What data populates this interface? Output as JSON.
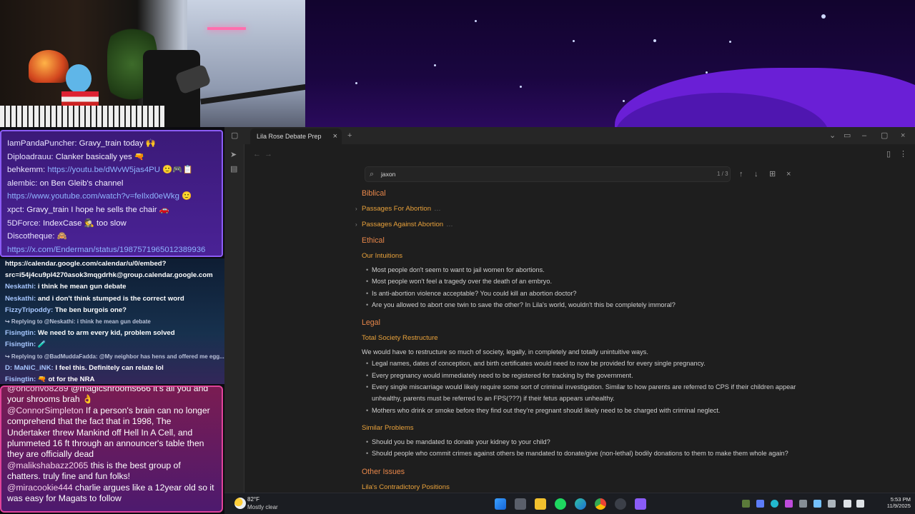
{
  "chat1": {
    "lines": [
      {
        "user": "IamPandaPuncher:",
        "text": " Gravy_train today 🙌"
      },
      {
        "user": "Diploadrauu:",
        "text": " Clanker basically yes 🔫"
      },
      {
        "user": "behkemm:",
        "link": " https://youtu.be/dWvW5jas4PU",
        "text": " 🙂🎮📋"
      },
      {
        "user": "alembic:",
        "text": " on Ben Gleib's channel"
      },
      {
        "user": "",
        "link": "https://www.youtube.com/watch?v=feIlxd0eWkg",
        "text": " 🙂"
      },
      {
        "user": "xpct:",
        "text": " Gravy_train I hope he sells the chair 🚗"
      },
      {
        "user": "5DForce:",
        "text": " IndexCase 🕵 too slow"
      },
      {
        "user": "Discotheque:",
        "text": " 🙈"
      },
      {
        "user": "",
        "link": "https://x.com/Enderman/status/1987571965012389936",
        "text": ""
      }
    ]
  },
  "chat2": {
    "lines": [
      {
        "kind": "msg",
        "user": "",
        "text": "https://calendar.google.com/calendar/u/0/embed?"
      },
      {
        "kind": "msg",
        "user": "",
        "text": "src=i54j4cu9pl4270asok3mqgdrhk@group.calendar.google.com"
      },
      {
        "kind": "msg",
        "user": "Neskathi:",
        "text": " i think he mean gun debate"
      },
      {
        "kind": "msg",
        "user": "Neskathi:",
        "text": " and i don't think stumped is the correct word"
      },
      {
        "kind": "msg",
        "user": "FizzyTripoddy:",
        "text": " The ben burgois one?"
      },
      {
        "kind": "reply",
        "user": "",
        "text": "↪ Replying to @Neskathi: i think he mean gun debate"
      },
      {
        "kind": "msg",
        "user": "Fisingtin:",
        "text": " We need to arm every kid, problem solved"
      },
      {
        "kind": "msg",
        "user": "Fisingtin:",
        "text": " 🧪"
      },
      {
        "kind": "reply",
        "user": "",
        "text": "↪ Replying to @BadMuddaFadda: @My neighbor has hens and offered me egg..."
      },
      {
        "kind": "msg",
        "user": "D: MaNiC_iNK:",
        "text": " I feel this. Definitely can relate lol"
      },
      {
        "kind": "msg",
        "user": "Fisingtin:",
        "text": " 🔫 ot for the NRA"
      }
    ]
  },
  "chat3": {
    "lines": [
      {
        "user": "@onconvo8289",
        "text": " @magicshrooms666 it's all you and your shrooms brah 👌"
      },
      {
        "user": "@ConnorSimpleton",
        "text": " If a person's brain can no longer comprehend that the fact that in 1998, The Undertaker threw Mankind off Hell In A Cell, and plummeted 16 ft through an announcer's table then they are officially dead"
      },
      {
        "user": "@malikshabazz2065",
        "text": " this is the best group of chatters. truly fine and fun folks!"
      },
      {
        "user": "@miracookie444",
        "text": " charlie argues like a 12year old so it was easy for Magats to follow"
      }
    ]
  },
  "app": {
    "tab_title": "Lila Rose Debate Prep",
    "search": {
      "query": "jaxon",
      "count": "1 / 3"
    },
    "doc": {
      "biblical": "Biblical",
      "passages_for": "Passages For Abortion",
      "passages_against": "Passages Against Abortion",
      "ethical": "Ethical",
      "our_intuitions": "Our Intuitions",
      "intuitions": [
        "Most people don't seem to want to jail women for abortions.",
        "Most people won't feel a tragedy over the death of an embryo.",
        "Is anti-abortion violence acceptable? You could kill an abortion doctor?",
        "Are you allowed to abort one twin to save the other? In Lila's world, wouldn't this be completely immoral?"
      ],
      "legal": "Legal",
      "total_society": "Total Society Restructure",
      "total_society_para": "We would have to restructure so much of society, legally, in completely and totally unintuitive ways.",
      "restructure_points": [
        "Legal names, dates of conception, and birth certificates would need to now be provided for every single pregnancy.",
        "Every pregnancy would immediately need to be registered for tracking by the government.",
        "Every single miscarriage would likely require some sort of criminal investigation. Similar to how parents are referred to CPS if their children appear unhealthy, parents must be referred to an FPS(???) if their fetus appears unhealthy.",
        "Mothers who drink or smoke before they find out they're pregnant should likely need to be charged with criminal neglect."
      ],
      "similar_problems": "Similar Problems",
      "similar_points": [
        "Should you be mandated to donate your kidney to your child?",
        "Should people who commit crimes against others be mandated to donate/give (non-lethal) bodily donations to them to make them whole again?"
      ],
      "other_issues": "Other Issues",
      "contradictory": "Lila's Contradictory Positions"
    }
  },
  "taskbar": {
    "temperature": "82°F",
    "condition": "Mostly clear",
    "time": "5:53 PM",
    "date": "11/9/2025"
  },
  "colors": {
    "heading": "#e8874a",
    "subheading": "#e9a23b",
    "chat1_border": "#8b5cf6",
    "chat3_border": "#e0439a"
  }
}
